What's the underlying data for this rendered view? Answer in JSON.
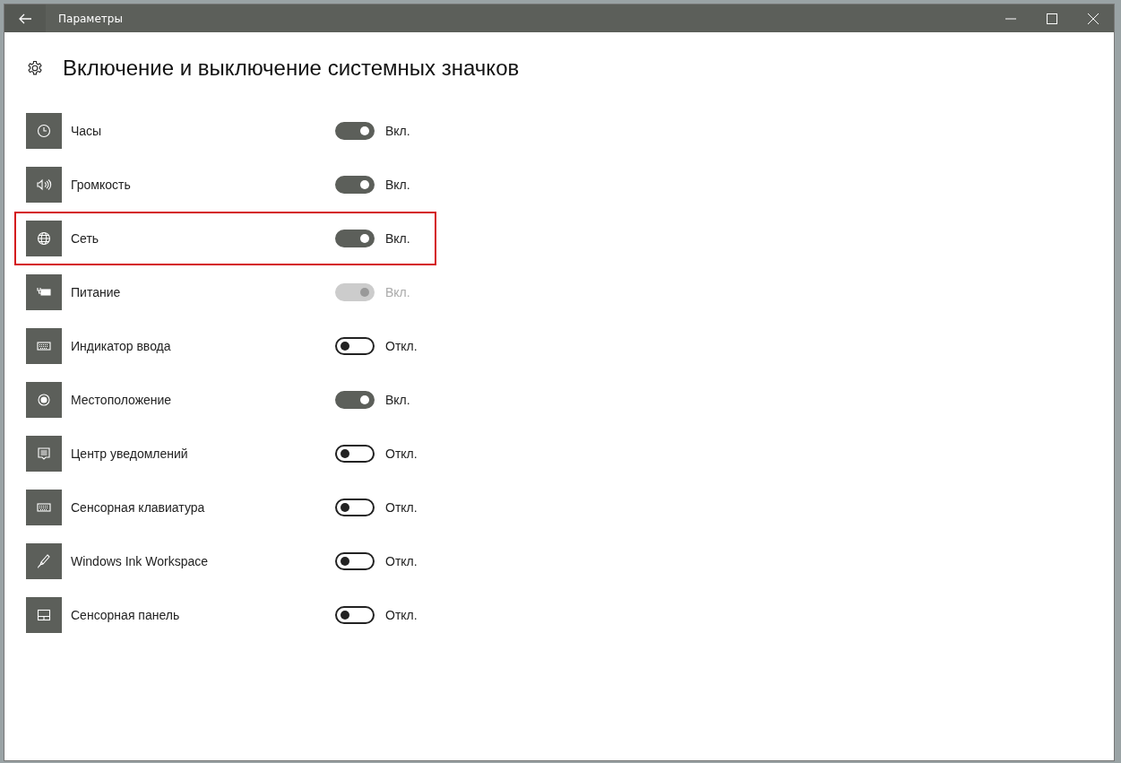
{
  "window": {
    "title": "Параметры"
  },
  "heading": "Включение и выключение системных значков",
  "items": [
    {
      "label": "Часы",
      "on": true,
      "disabled": false,
      "highlighted": false,
      "state_text": "Вкл."
    },
    {
      "label": "Громкость",
      "on": true,
      "disabled": false,
      "highlighted": false,
      "state_text": "Вкл."
    },
    {
      "label": "Сеть",
      "on": true,
      "disabled": false,
      "highlighted": true,
      "state_text": "Вкл."
    },
    {
      "label": "Питание",
      "on": true,
      "disabled": true,
      "highlighted": false,
      "state_text": "Вкл."
    },
    {
      "label": "Индикатор ввода",
      "on": false,
      "disabled": false,
      "highlighted": false,
      "state_text": "Откл."
    },
    {
      "label": "Местоположение",
      "on": true,
      "disabled": false,
      "highlighted": false,
      "state_text": "Вкл."
    },
    {
      "label": "Центр уведомлений",
      "on": false,
      "disabled": false,
      "highlighted": false,
      "state_text": "Откл."
    },
    {
      "label": "Сенсорная клавиатура",
      "on": false,
      "disabled": false,
      "highlighted": false,
      "state_text": "Откл."
    },
    {
      "label": "Windows Ink Workspace",
      "on": false,
      "disabled": false,
      "highlighted": false,
      "state_text": "Откл."
    },
    {
      "label": "Сенсорная панель",
      "on": false,
      "disabled": false,
      "highlighted": false,
      "state_text": "Откл."
    }
  ]
}
